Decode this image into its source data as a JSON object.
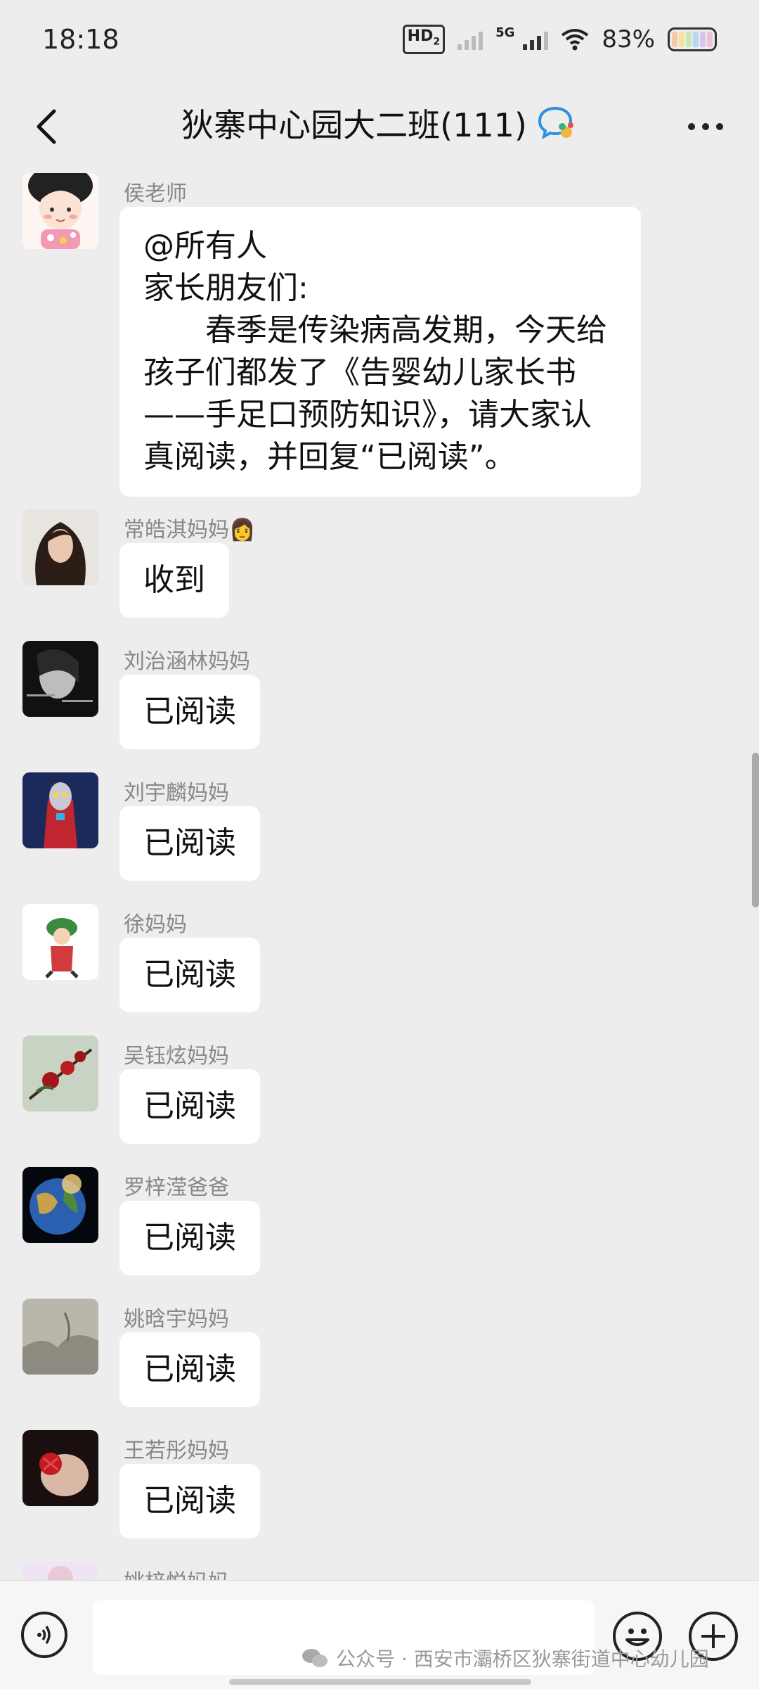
{
  "status_bar": {
    "time": "18:18",
    "hd_badge": "HD",
    "hd_sub": "2",
    "network": "5G",
    "battery_percent": "83%"
  },
  "header": {
    "title": "狄寨中心园大二班(111)",
    "icons": [
      "back-arrow-icon",
      "chat-group-icon",
      "more-dots-icon"
    ]
  },
  "messages": [
    {
      "sender": "侯老师",
      "lines": [
        "@所有人",
        "家长朋友们:",
        "　　春季是传染病高发期，今天给",
        "孩子们都发了《告婴幼儿家长书",
        "——手足口预防知识》，请大家认",
        "真阅读，并回复“已阅读”。"
      ]
    },
    {
      "sender": "常皓淇妈妈",
      "sender_emoji": "👩",
      "text": "收到"
    },
    {
      "sender": "刘治涵林妈妈",
      "text": "已阅读"
    },
    {
      "sender": "刘宇麟妈妈",
      "text": "已阅读"
    },
    {
      "sender": "徐妈妈",
      "text": "已阅读"
    },
    {
      "sender": "吴钰炫妈妈",
      "text": "已阅读"
    },
    {
      "sender": "罗梓滢爸爸",
      "text": "已阅读"
    },
    {
      "sender": "姚晗宇妈妈",
      "text": "已阅读"
    },
    {
      "sender": "王若彤妈妈",
      "text": "已阅读"
    },
    {
      "sender": "姚梓悦妈妈"
    }
  ],
  "input_bar": {
    "watermark": "公众号 · 西安市灞桥区狄寨街道中心幼儿园"
  },
  "colors": {
    "background": "#ededed",
    "bubble": "#ffffff",
    "sender_name": "#888888"
  }
}
